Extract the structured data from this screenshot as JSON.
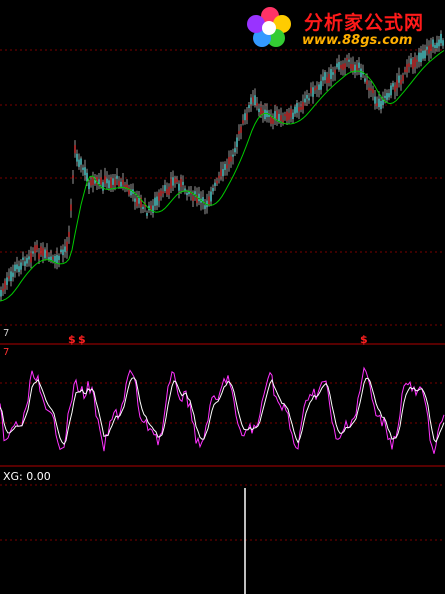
{
  "logo": {
    "name": "分析家公式网",
    "url": "www.88gs.com",
    "icon": "flower-icon",
    "color_text": "#ff1a1a",
    "color_url": "#ffb000"
  },
  "price_panel": {
    "colors": {
      "grid": "#7a0000",
      "ma": "#00cc00",
      "up": "#ff4040",
      "down": "#66ffff",
      "wick": "#ffffff"
    }
  },
  "signal_panel": {
    "top_label": "7",
    "mid_label": "7",
    "marker": "$",
    "marker_color": "#ff2020",
    "markers_text": [
      "$",
      "$",
      "$"
    ]
  },
  "oscillator_panel": {
    "colors": {
      "k": "#ff33ff",
      "d": "#ffffff",
      "grid": "#7a0000"
    }
  },
  "xg_panel": {
    "label": "XG: 0.00"
  },
  "chart_data": {
    "type": "line",
    "series": []
  }
}
